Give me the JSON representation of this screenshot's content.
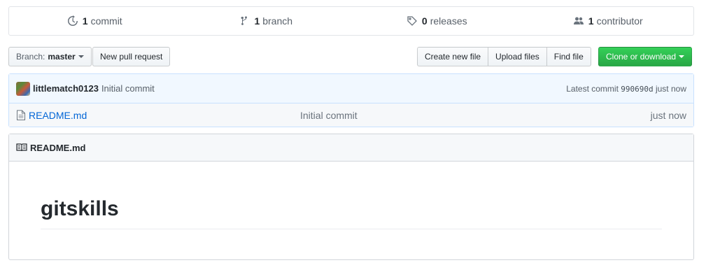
{
  "numbers_summary": {
    "commits": {
      "count": "1",
      "label": "commit",
      "icon": "history-icon"
    },
    "branches": {
      "count": "1",
      "label": "branch",
      "icon": "branch-icon"
    },
    "releases": {
      "count": "0",
      "label": "releases",
      "icon": "tag-icon"
    },
    "contributors": {
      "count": "1",
      "label": "contributor",
      "icon": "people-icon"
    }
  },
  "toolbar": {
    "branch_prefix": "Branch:",
    "branch_name": "master",
    "new_pull_request": "New pull request",
    "create_new_file": "Create new file",
    "upload_files": "Upload files",
    "find_file": "Find file",
    "clone_or_download": "Clone or download"
  },
  "commit_tease": {
    "author": "littlematch0123",
    "message": "Initial commit",
    "latest_label": "Latest commit",
    "sha": "990690d",
    "age": "just now"
  },
  "files": [
    {
      "name": "README.md",
      "message": "Initial commit",
      "age": "just now",
      "icon": "file-icon"
    }
  ],
  "readme": {
    "filename": "README.md",
    "heading": "gitskills",
    "icon": "book-icon"
  },
  "colors": {
    "link": "#0366d6",
    "clone_green": "#28a745",
    "commit_bg": "#f1f8ff"
  }
}
